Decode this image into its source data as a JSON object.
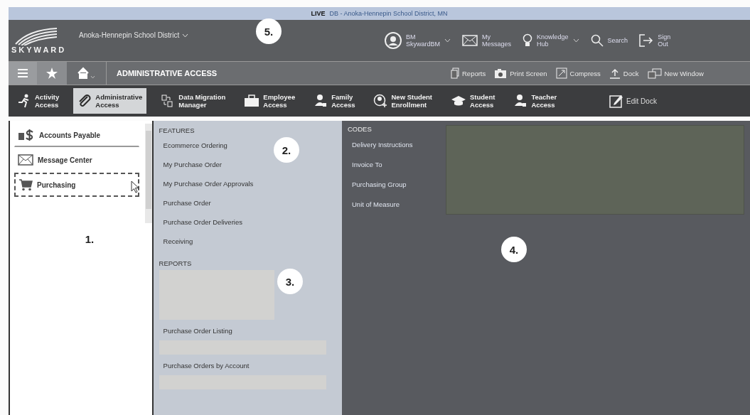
{
  "env_bar": {
    "badge": "LIVE",
    "text": "DB - Anoka-Hennepin School District, MN"
  },
  "header": {
    "logo": "SKYWARD",
    "district": "Anoka-Hennepin School District",
    "items": [
      {
        "kind": "user",
        "lines": [
          "BM",
          "SkywardBM"
        ],
        "dropdown": true
      },
      {
        "kind": "messages",
        "lines": [
          "My",
          "Messages"
        ],
        "dropdown": false
      },
      {
        "kind": "knowledge",
        "lines": [
          "Knowledge",
          "Hub"
        ],
        "dropdown": true
      },
      {
        "kind": "search",
        "lines": [
          "Search"
        ],
        "dropdown": false
      },
      {
        "kind": "signout",
        "lines": [
          "Sign",
          "Out"
        ],
        "dropdown": false
      }
    ]
  },
  "nav": {
    "title": "ADMINISTRATIVE ACCESS",
    "actions": [
      {
        "kind": "reports",
        "label": "Reports"
      },
      {
        "kind": "print",
        "label": "Print Screen"
      },
      {
        "kind": "compress",
        "label": "Compress"
      },
      {
        "kind": "dock",
        "label": "Dock"
      },
      {
        "kind": "window",
        "label": "New Window"
      }
    ]
  },
  "dock": {
    "items": [
      {
        "kind": "activity",
        "lines": [
          "Activity",
          "Access"
        ],
        "selected": false
      },
      {
        "kind": "admin",
        "lines": [
          "Administrative",
          "Access"
        ],
        "selected": true
      },
      {
        "kind": "migration",
        "lines": [
          "Data Migration",
          "Manager"
        ],
        "selected": false
      },
      {
        "kind": "employee",
        "lines": [
          "Employee",
          "Access"
        ],
        "selected": false
      },
      {
        "kind": "family",
        "lines": [
          "Family",
          "Access"
        ],
        "selected": false
      },
      {
        "kind": "enroll",
        "lines": [
          "New Student",
          "Enrollment"
        ],
        "selected": false
      },
      {
        "kind": "student",
        "lines": [
          "Student",
          "Access"
        ],
        "selected": false
      },
      {
        "kind": "teacher",
        "lines": [
          "Teacher",
          "Access"
        ],
        "selected": false
      }
    ],
    "edit": "Edit Dock"
  },
  "sidebar": {
    "items": [
      {
        "kind": "payable",
        "label": "Accounts Payable",
        "selected": false
      },
      {
        "kind": "message",
        "label": "Message Center",
        "selected": false
      },
      {
        "kind": "cart",
        "label": "Purchasing",
        "selected": true
      }
    ]
  },
  "features": {
    "heading": "FEATURES",
    "items": [
      "Ecommerce Ordering",
      "My Purchase Order",
      "My Purchase Order Approvals",
      "Purchase Order",
      "Purchase Order Deliveries",
      "Receiving"
    ]
  },
  "reports": {
    "heading": "REPORTS",
    "items": [
      "Purchase Order Listing",
      "Purchase Orders by Account"
    ]
  },
  "codes": {
    "heading": "CODES",
    "items": [
      "Delivery Instructions",
      "Invoice To",
      "Purchasing Group",
      "Unit of Measure"
    ]
  },
  "callouts": [
    "5.",
    "2.",
    "1.",
    "3.",
    "4."
  ]
}
